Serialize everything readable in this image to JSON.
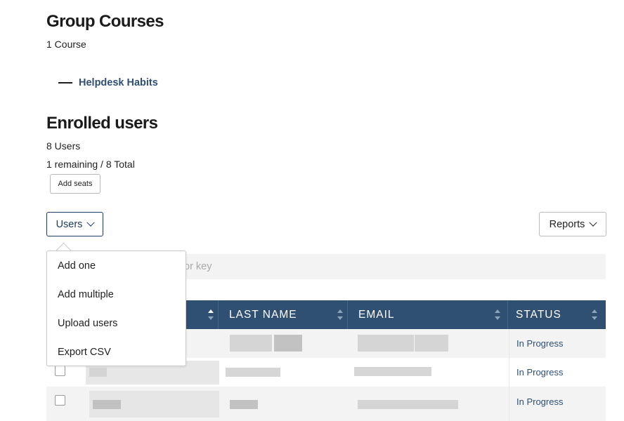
{
  "group_courses": {
    "title": "Group Courses",
    "count": "1 Course",
    "courses": [
      {
        "name": "Helpdesk Habits"
      }
    ]
  },
  "enrolled": {
    "title": "Enrolled users",
    "count": "8 Users",
    "seats": "1 remaining / 8 Total",
    "add_seats_label": "Add seats"
  },
  "toolbar": {
    "users_label": "Users",
    "reports_label": "Reports",
    "search_placeholder_visible": "or key"
  },
  "users_menu": {
    "items": [
      {
        "label": "Add one"
      },
      {
        "label": "Add multiple"
      },
      {
        "label": "Upload users"
      },
      {
        "label": "Export CSV"
      }
    ]
  },
  "table": {
    "columns": [
      {
        "label": ""
      },
      {
        "label": "LAST NAME"
      },
      {
        "label": "EMAIL"
      },
      {
        "label": "STATUS"
      }
    ],
    "rows": [
      {
        "status": "In Progress"
      },
      {
        "status": "In Progress"
      },
      {
        "status": "In Progress"
      }
    ]
  },
  "colors": {
    "accent": "#2f4f73",
    "header_bg": "#2f4f73",
    "users_button_border": "#1f3c67",
    "row_alt_bg": "#f3f3f3"
  },
  "icons": {
    "dropdown": "chevron-down-icon",
    "sort": "sort-arrows-icon",
    "course_bullet": "dash-icon"
  }
}
